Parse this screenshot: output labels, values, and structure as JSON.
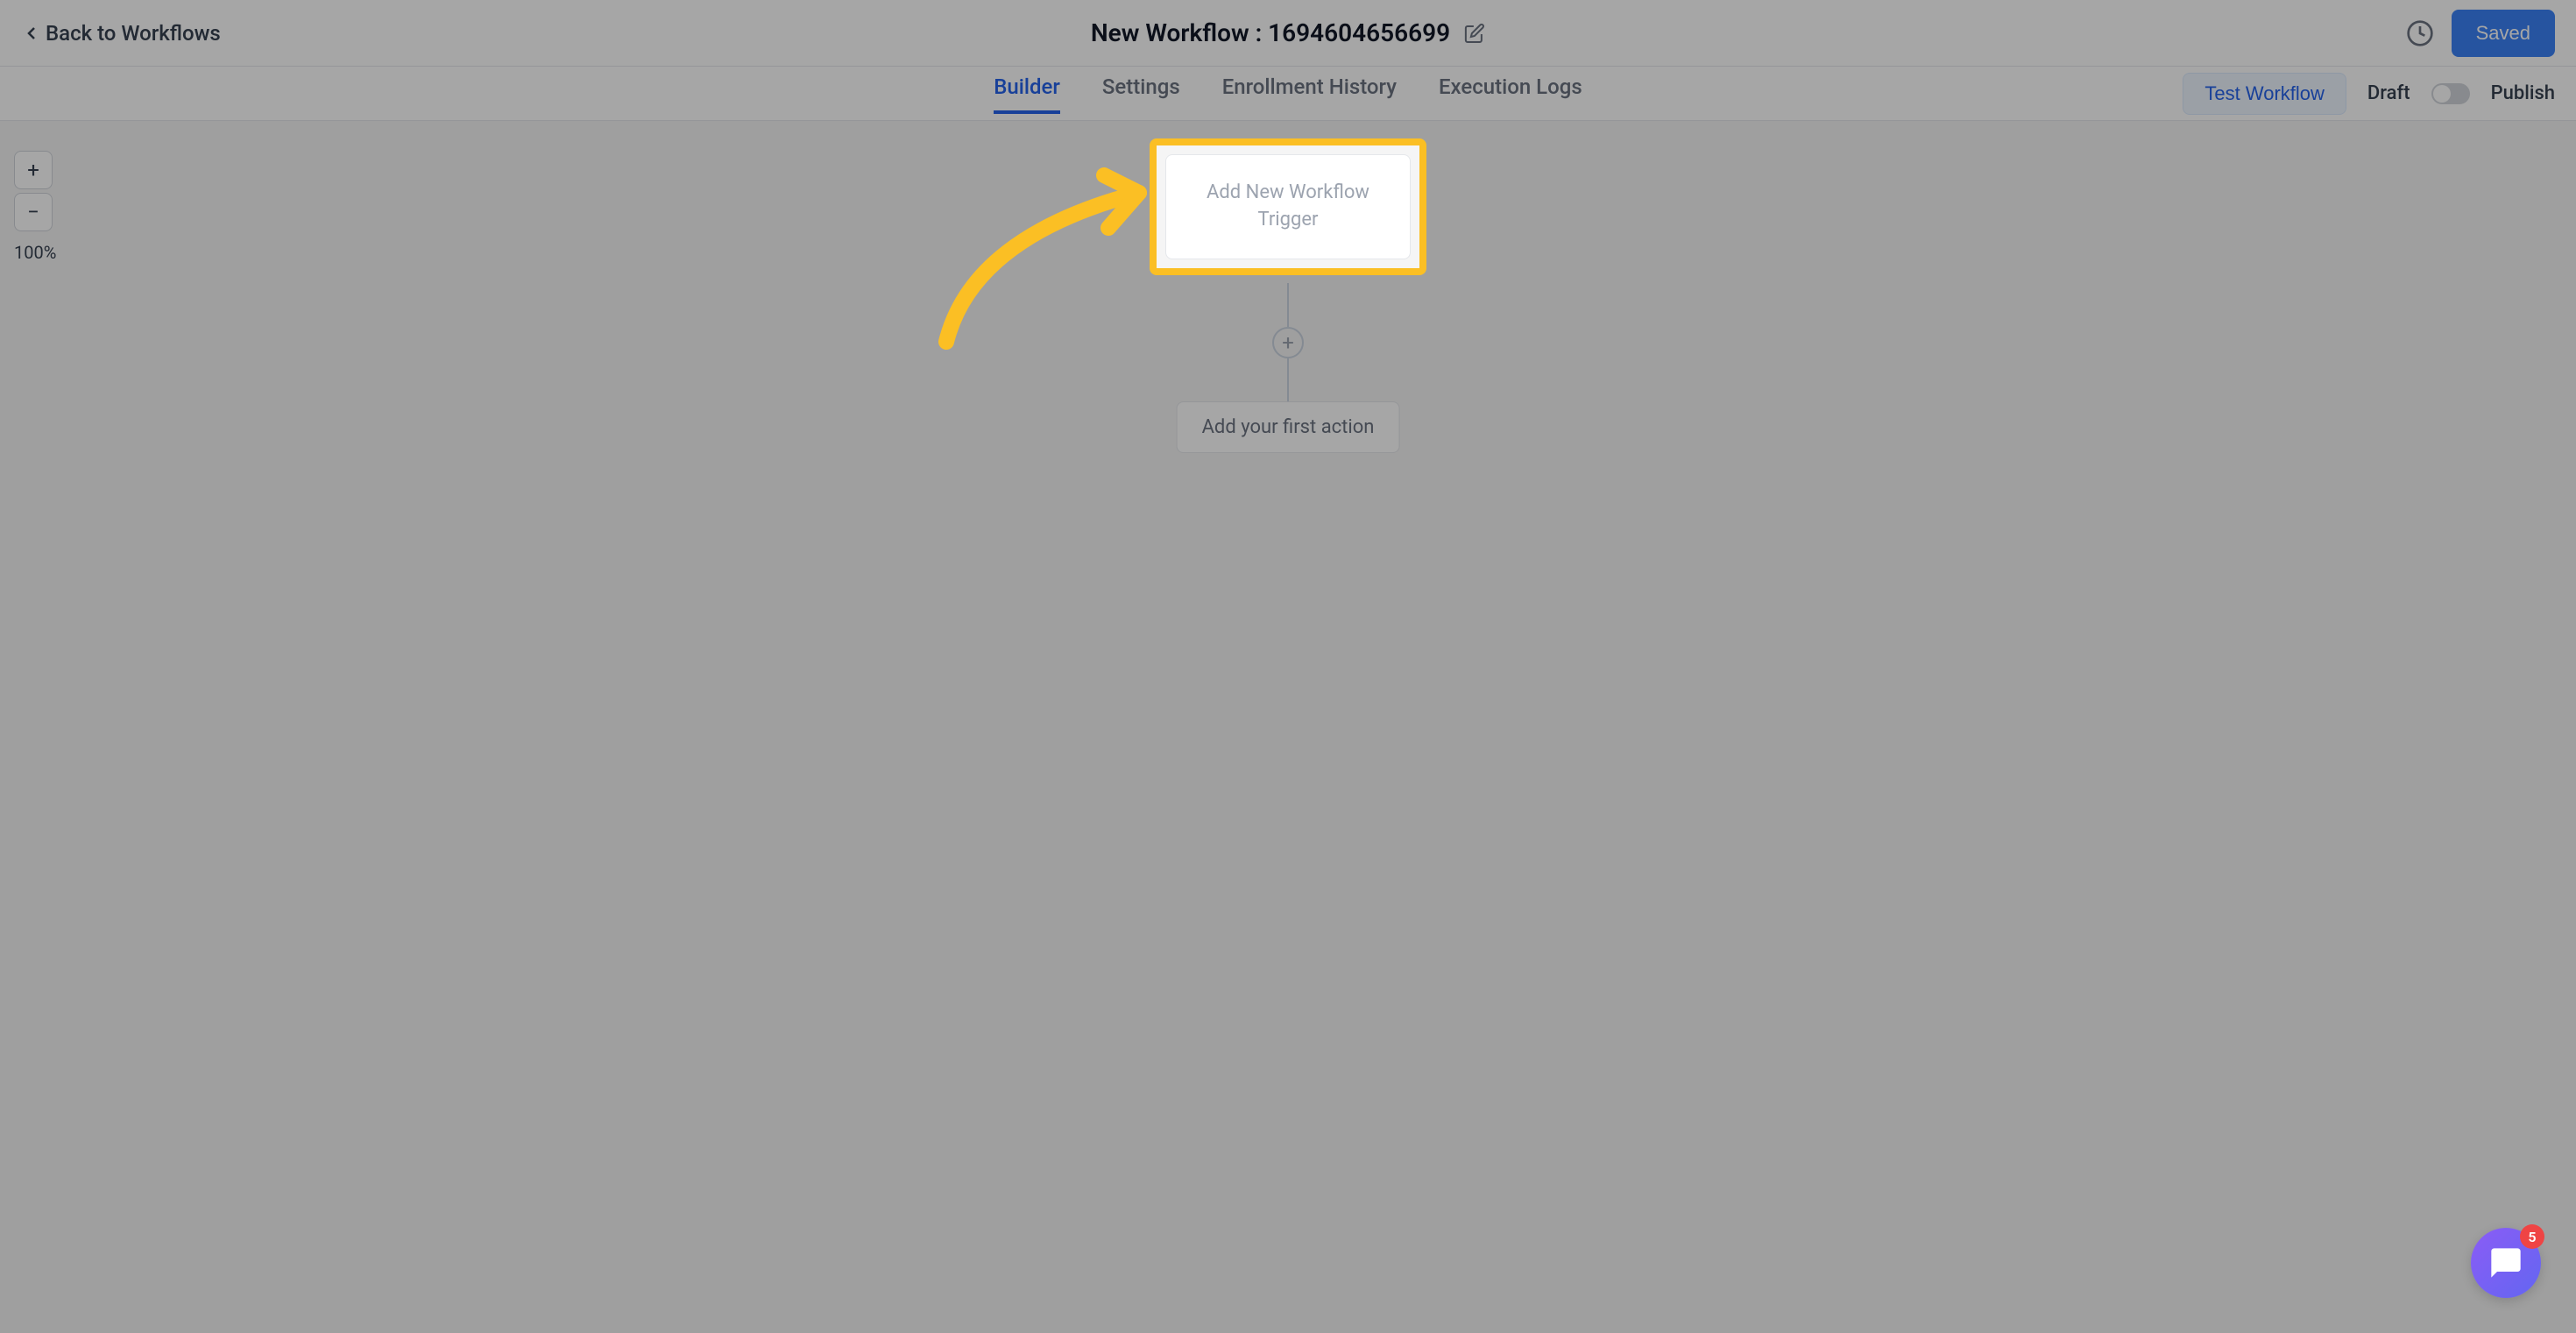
{
  "header": {
    "back_label": "Back to Workflows",
    "title": "New Workflow : 1694604656699",
    "saved_button": "Saved"
  },
  "tabs": {
    "builder": "Builder",
    "settings": "Settings",
    "enrollment_history": "Enrollment History",
    "execution_logs": "Execution Logs",
    "test_workflow": "Test Workflow",
    "draft_label": "Draft",
    "publish_label": "Publish"
  },
  "zoom": {
    "plus": "+",
    "minus": "−",
    "level": "100%"
  },
  "canvas": {
    "trigger_label": "Add New Workflow Trigger",
    "first_action_label": "Add your first action"
  },
  "chat": {
    "badge_count": "5"
  }
}
